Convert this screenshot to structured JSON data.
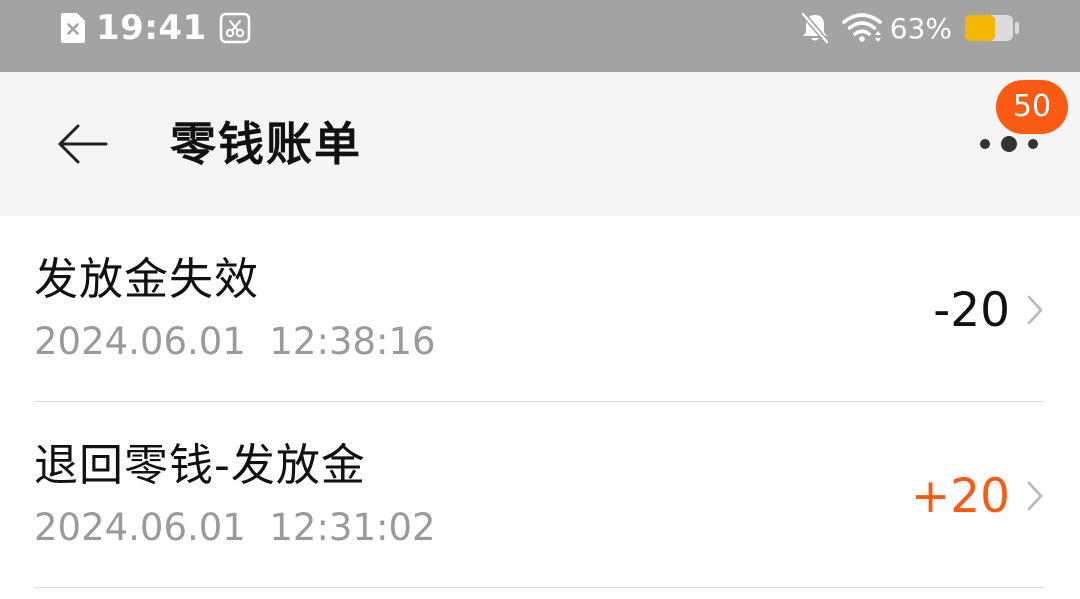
{
  "status_bar": {
    "time": "19:41",
    "battery_percent": "63%",
    "battery_level": 0.63,
    "icons": [
      "document-x-icon",
      "screenshot-icon",
      "bell-muted-icon",
      "wifi-icon",
      "battery-icon"
    ]
  },
  "header": {
    "back_icon": "arrow-left-icon",
    "title": "零钱账单",
    "more_icon": "more-dots-icon",
    "badge_count": "50"
  },
  "bills": [
    {
      "title": "发放金失效",
      "time": "2024.06.01  12:38:16",
      "amount": "-20",
      "type": "negative"
    },
    {
      "title": "退回零钱-发放金",
      "time": "2024.06.01  12:31:02",
      "amount": "+20",
      "type": "positive"
    }
  ],
  "colors": {
    "status_bar_bg": "#a3a3a3",
    "header_bg": "#f5f5f5",
    "accent_orange": "#fa5a12",
    "battery_fill": "#f5b800",
    "secondary_text": "#9a9a9a"
  }
}
